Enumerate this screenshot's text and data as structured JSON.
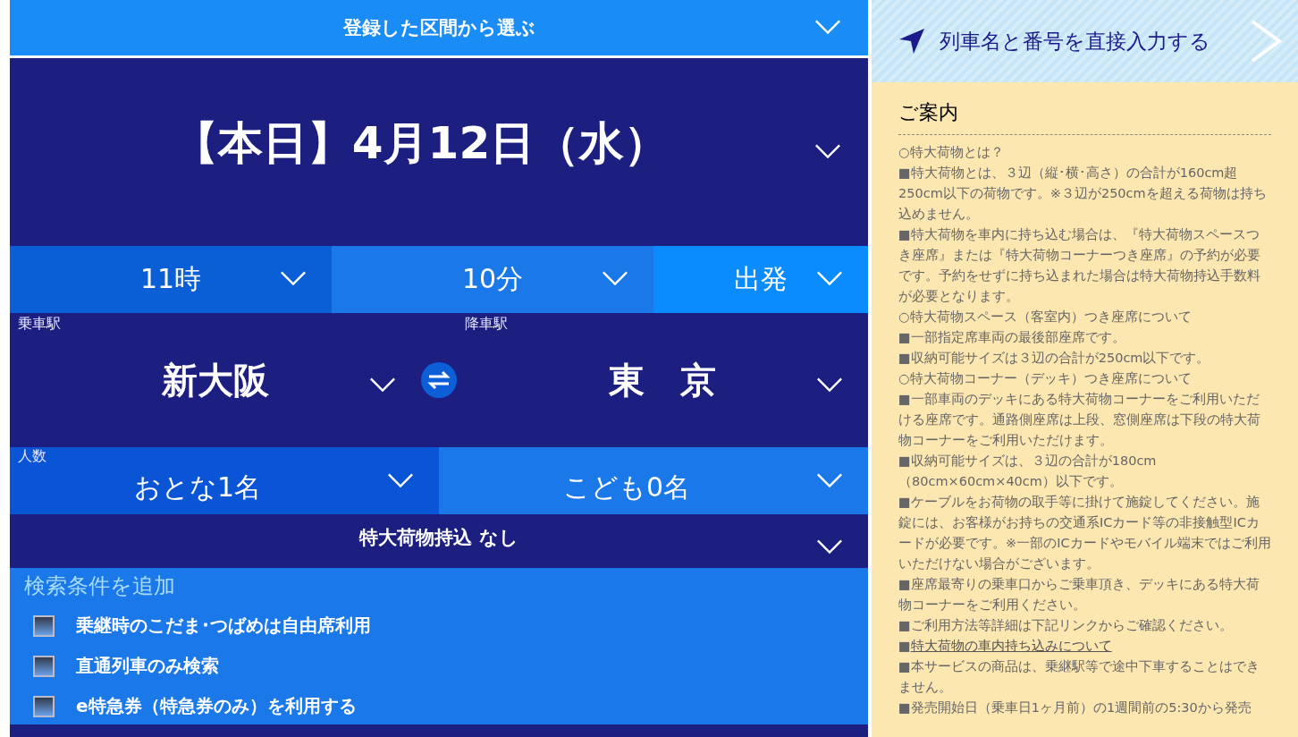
{
  "route_selector": {
    "label": "登録した区間から選ぶ"
  },
  "date": {
    "label": "【本日】4月12日（水）"
  },
  "time": {
    "hour": "11時",
    "minute": "10分",
    "mode": "出発"
  },
  "stations": {
    "departure_label": "乗車駅",
    "departure": "新大阪",
    "arrival_label": "降車駅",
    "arrival": "東　京"
  },
  "passengers": {
    "label": "人数",
    "adults": "おとな1名",
    "children": "こども0名"
  },
  "baggage": {
    "label": "特大荷物持込 なし"
  },
  "options": {
    "title": "検索条件を追加",
    "items": [
      {
        "label": "乗継時のこだま･つばめは自由席利用",
        "checked": false
      },
      {
        "label": "直通列車のみ検索",
        "checked": false
      },
      {
        "label": "e特急券（特急券のみ）を利用する",
        "checked": false
      }
    ]
  },
  "direct_entry": {
    "label": "列車名と番号を直接入力する"
  },
  "info": {
    "title": "ご案内",
    "items": [
      {
        "kind": "text",
        "text": "○特大荷物とは？"
      },
      {
        "kind": "text",
        "text": "■特大荷物とは、３辺（縦･横･高さ）の合計が160cm超250cm以下の荷物です。※３辺が250cmを超える荷物は持ち込めません。"
      },
      {
        "kind": "text",
        "text": "■特大荷物を車内に持ち込む場合は、『特大荷物スペースつき座席』または『特大荷物コーナーつき座席』の予約が必要です。予約をせずに持ち込まれた場合は特大荷物持込手数料が必要となります。"
      },
      {
        "kind": "text",
        "text": "○特大荷物スペース（客室内）つき座席について"
      },
      {
        "kind": "text",
        "text": "■一部指定席車両の最後部座席です。"
      },
      {
        "kind": "text",
        "text": "■収納可能サイズは３辺の合計が250cm以下です。"
      },
      {
        "kind": "text",
        "text": "○特大荷物コーナー（デッキ）つき座席について"
      },
      {
        "kind": "text",
        "text": "■一部車両のデッキにある特大荷物コーナーをご利用いただける座席です。通路側座席は上段、窓側座席は下段の特大荷物コーナーをご利用いただけます。"
      },
      {
        "kind": "text",
        "text": "■収納可能サイズは、３辺の合計が180cm（80cm×60cm×40cm）以下です。"
      },
      {
        "kind": "text",
        "text": "■ケーブルをお荷物の取手等に掛けて施錠してください。施錠には、お客様がお持ちの交通系ICカード等の非接触型ICカードが必要です。※一部のICカードやモバイル端末ではご利用いただけない場合がございます。"
      },
      {
        "kind": "text",
        "text": "■座席最寄りの乗車口からご乗車頂き、デッキにある特大荷物コーナーをご利用ください。"
      },
      {
        "kind": "text",
        "text": "■ご利用方法等詳細は下記リンクからご確認ください。"
      },
      {
        "kind": "link",
        "marker": "■",
        "text": "特大荷物の車内持ち込みについて"
      },
      {
        "kind": "text",
        "text": "■本サービスの商品は、乗継駅等で途中下車することはできません。"
      },
      {
        "kind": "text",
        "text": "■発売開始日（乗車日1ヶ月前）の1週間前の5:30から発売"
      }
    ]
  }
}
